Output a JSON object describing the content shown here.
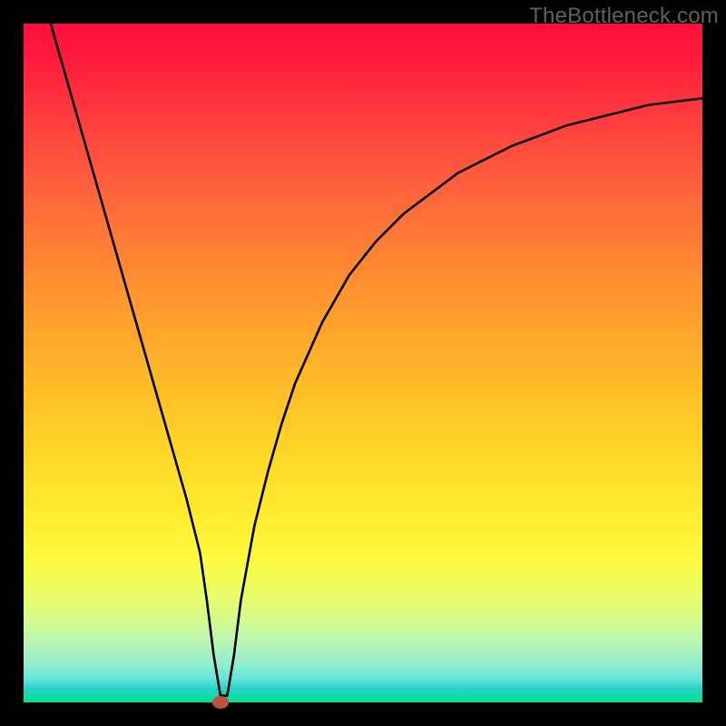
{
  "attribution": "TheBottleneck.com",
  "chart_data": {
    "type": "line",
    "title": "",
    "xlabel": "",
    "ylabel": "",
    "x_range": [
      0,
      100
    ],
    "y_range": [
      0,
      100
    ],
    "series": [
      {
        "name": "bottleneck-curve",
        "x": [
          4,
          6,
          8,
          10,
          12,
          14,
          16,
          18,
          20,
          22,
          24,
          26,
          27,
          28,
          29,
          30,
          31,
          32,
          34,
          36,
          38,
          40,
          44,
          48,
          52,
          56,
          60,
          64,
          68,
          72,
          76,
          80,
          84,
          88,
          92,
          96,
          100
        ],
        "values": [
          100,
          93,
          86,
          79,
          72,
          65,
          58,
          51,
          44,
          37,
          30,
          22,
          15,
          7,
          1,
          1,
          7,
          15,
          26,
          34,
          41,
          47,
          56,
          63,
          68,
          72,
          75,
          78,
          80,
          82,
          83.5,
          85,
          86,
          87,
          88,
          88.5,
          89
        ]
      }
    ],
    "marker": {
      "x": 29,
      "y": 0
    },
    "gradient_colors": {
      "top": "#fe0d3b",
      "mid_top": "#ff7537",
      "mid": "#ffd327",
      "mid_bottom": "#fff83a",
      "bottom": "#00e28b"
    }
  }
}
